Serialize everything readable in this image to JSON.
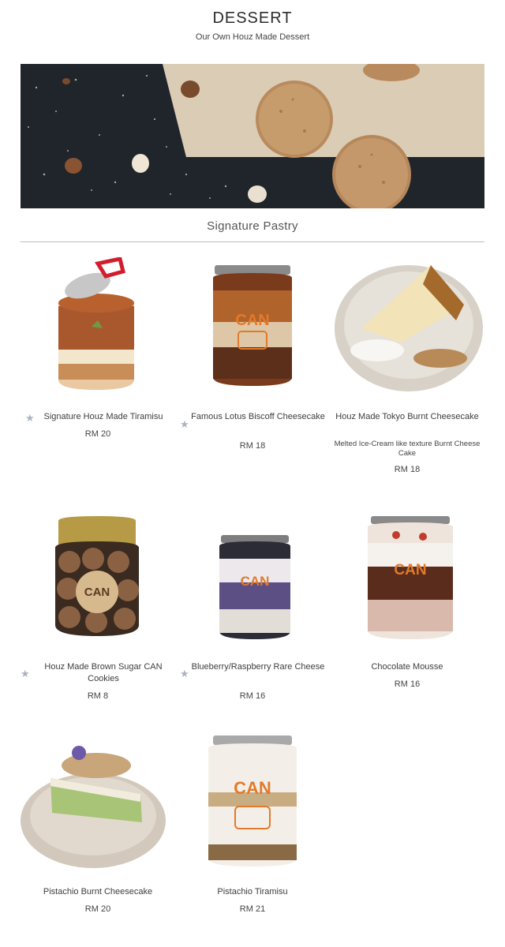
{
  "header": {
    "title": "DESSERT",
    "subtitle": "Our Own Houz Made Dessert"
  },
  "section": {
    "title": "Signature Pastry"
  },
  "icons": {
    "favorite": "star-icon"
  },
  "products": [
    {
      "name": "Signature Houz Made Tiramisu",
      "price": "RM 20",
      "description": "",
      "starred": true,
      "image": "tiramisu-can"
    },
    {
      "name": "Famous Lotus Biscoff Cheesecake",
      "price": "RM 18",
      "description": "",
      "starred": true,
      "image": "biscoff-can"
    },
    {
      "name": "Houz Made Tokyo Burnt Cheesecake",
      "price": "RM 18",
      "description": "Melted Ice-Cream like texture Burnt Cheese Cake",
      "starred": false,
      "image": "burnt-cheesecake-plate"
    },
    {
      "name": "Houz Made Brown Sugar CAN Cookies",
      "price": "RM 8",
      "description": "",
      "starred": true,
      "image": "cookies-can"
    },
    {
      "name": "Blueberry/Raspberry Rare Cheese",
      "price": "RM 16",
      "description": "",
      "starred": true,
      "image": "blueberry-can"
    },
    {
      "name": "Chocolate Mousse",
      "price": "RM 16",
      "description": "",
      "starred": false,
      "image": "chocolate-can"
    },
    {
      "name": "Pistachio Burnt Cheesecake",
      "price": "RM 20",
      "description": "",
      "starred": false,
      "image": "pistachio-plate"
    },
    {
      "name": "Pistachio Tiramisu",
      "price": "RM 21",
      "description": "",
      "starred": false,
      "image": "pistachio-tiramisu-can"
    }
  ],
  "colors": {
    "text": "#3b3b3b",
    "rule": "#bdbdbd",
    "star": "#aab3bf",
    "brand_orange": "#e27a2b"
  }
}
